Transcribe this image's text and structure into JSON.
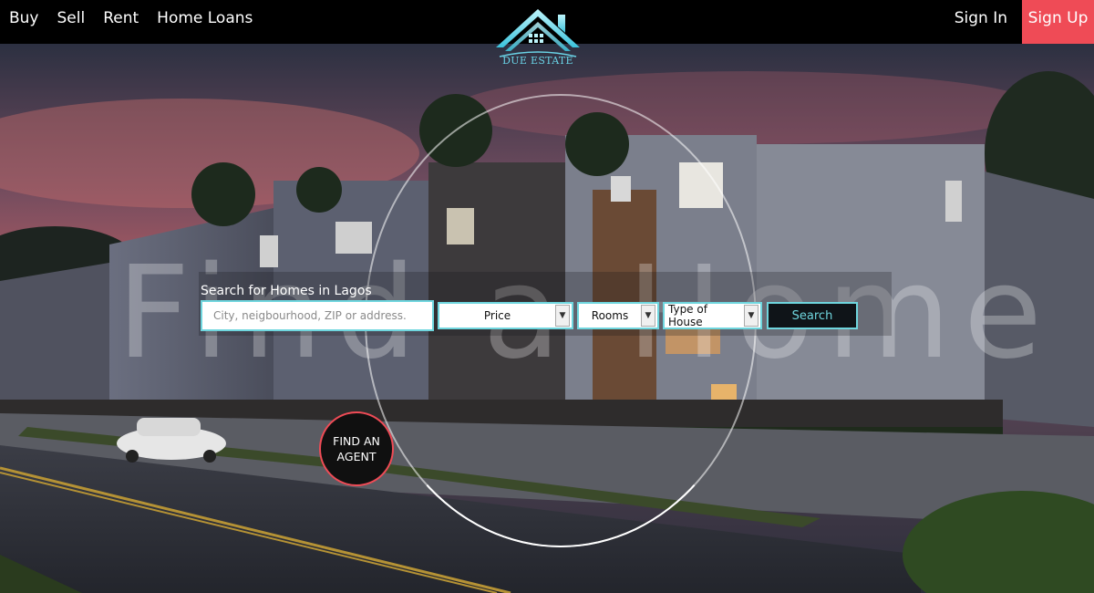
{
  "nav": {
    "left_links": [
      "Buy",
      "Sell",
      "Rent",
      "Home Loans"
    ],
    "sign_in": "Sign In",
    "sign_up": "Sign Up"
  },
  "logo": {
    "text": "DUE ESTATE",
    "icon": "house-roof-icon"
  },
  "hero": {
    "watermark": "Find a Home",
    "search_title": "Search for Homes in Lagos",
    "location_placeholder": "City, neigbourhood, ZIP or address.",
    "price_label": "Price",
    "rooms_label": "Rooms",
    "type_label": "Type of House",
    "search_button": "Search",
    "find_agent": "FIND AN AGENT"
  },
  "colors": {
    "accent": "#6fd6de",
    "signup": "#ef4b56",
    "nav_bg": "#000000"
  }
}
